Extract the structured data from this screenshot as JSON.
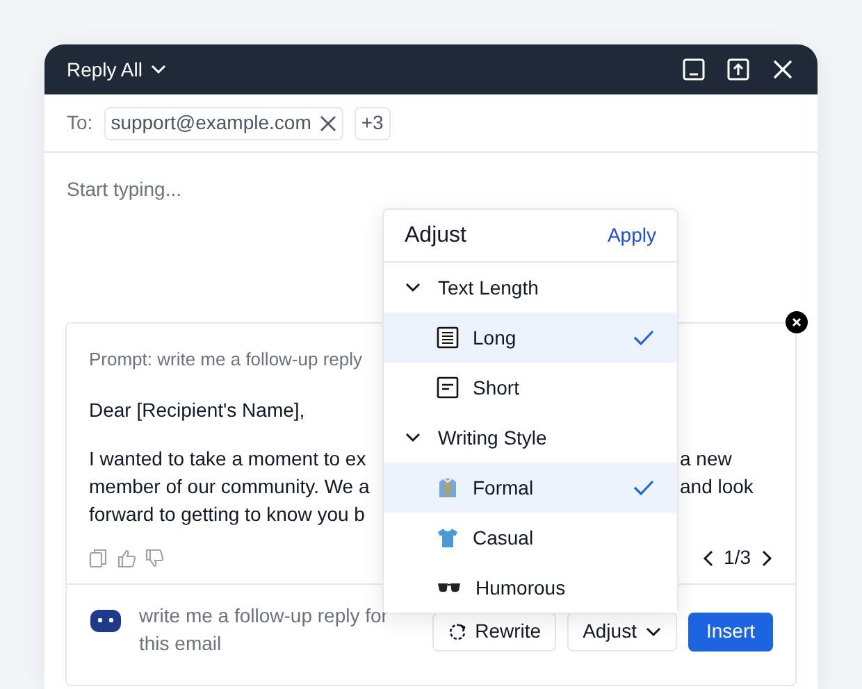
{
  "window": {
    "title": "Reply All"
  },
  "recipients": {
    "label": "To:",
    "chips": [
      {
        "address": "support@example.com"
      }
    ],
    "more": "+3"
  },
  "body": {
    "placeholder": "Start typing..."
  },
  "ai_result": {
    "prompt": "Prompt: write me a follow-up reply",
    "greeting": "Dear [Recipient's Name],",
    "lines": [
      {
        "left": "I wanted to take a moment to ex",
        "right": "a new"
      },
      {
        "left": "member of our community. We a",
        "right": "and look"
      },
      {
        "left": "forward to getting to know you b"
      }
    ],
    "pager": "1/3"
  },
  "composer": {
    "prompt": "write me a follow-up reply for this email",
    "buttons": [
      {
        "kind": "rewrite",
        "label": "Rewrite"
      },
      {
        "kind": "adjust",
        "label": "Adjust"
      },
      {
        "kind": "insert",
        "label": "Insert"
      }
    ]
  },
  "adjust_menu": {
    "title": "Adjust",
    "apply": "Apply",
    "sections": [
      {
        "title": "Text Length",
        "expanded": true,
        "items": [
          {
            "kind": "long",
            "label": "Long",
            "selected": true
          },
          {
            "kind": "short",
            "label": "Short",
            "selected": false
          }
        ]
      },
      {
        "title": "Writing Style",
        "expanded": true,
        "items": [
          {
            "kind": "formal",
            "label": "Formal",
            "selected": true
          },
          {
            "kind": "casual",
            "label": "Casual",
            "selected": false
          },
          {
            "kind": "humorous",
            "label": "Humorous",
            "selected": false
          }
        ]
      }
    ]
  }
}
